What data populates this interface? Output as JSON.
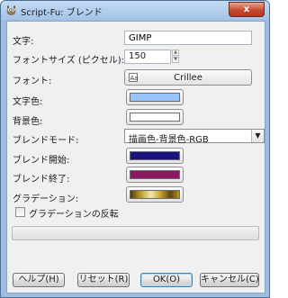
{
  "window": {
    "title": "Script-Fu: ブレンド",
    "close_label": "x"
  },
  "form": {
    "text_label": "文字:",
    "text_value": "GIMP",
    "font_size_label": "フォントサイズ (ピクセル):",
    "font_size_value": "150",
    "font_label": "フォント:",
    "font_value": "Crillee",
    "text_color_label": "文字色:",
    "text_color": "#99c3fb",
    "bg_color_label": "背景色:",
    "bg_color": "#ffffff",
    "blend_mode_label": "ブレンドモード:",
    "blend_mode_value": "描画色-背景色-RGB",
    "blend_start_label": "ブレンド開始:",
    "blend_start_color": "#1b1480",
    "blend_end_label": "ブレンド終了:",
    "blend_end_color": "#8a1760",
    "gradient_label": "グラデーション:",
    "gradient_reverse_label": "グラデーションの反転"
  },
  "buttons": {
    "help": "ヘルプ(H)",
    "reset": "リセット(R)",
    "ok": "OK(O)",
    "cancel": "キャンセル(C)"
  }
}
